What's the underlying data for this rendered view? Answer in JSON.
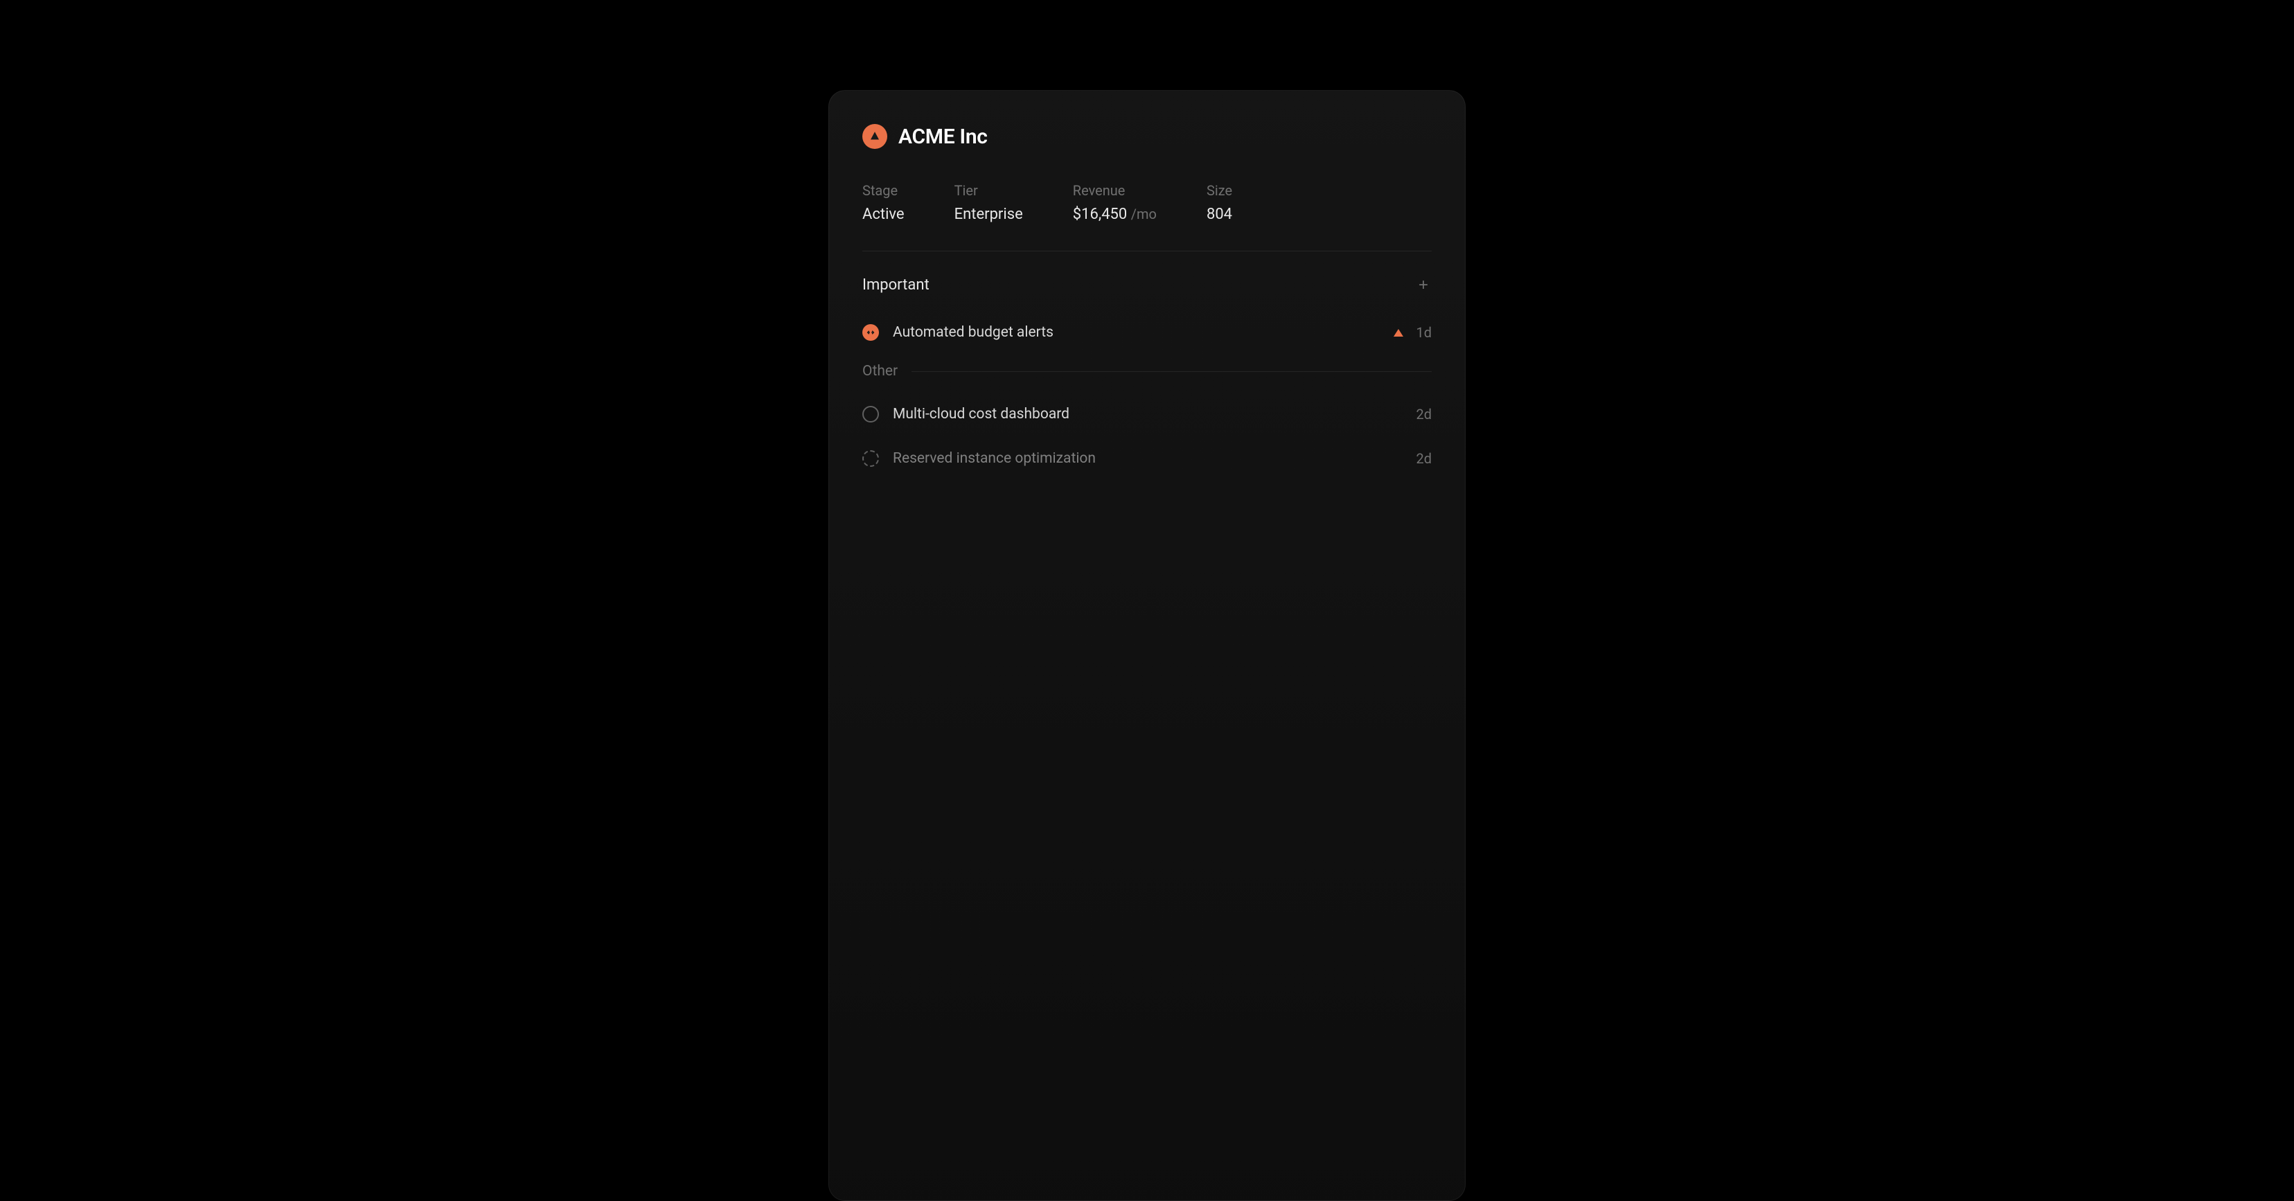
{
  "company": {
    "name": "ACME Inc"
  },
  "stats": {
    "stage": {
      "label": "Stage",
      "value": "Active"
    },
    "tier": {
      "label": "Tier",
      "value": "Enterprise"
    },
    "revenue": {
      "label": "Revenue",
      "value": "$16,450",
      "suffix": "/mo"
    },
    "size": {
      "label": "Size",
      "value": "804"
    }
  },
  "sections": {
    "important": {
      "title": "Important",
      "items": [
        {
          "title": "Automated budget alerts",
          "time": "1d"
        }
      ]
    },
    "other": {
      "title": "Other",
      "items": [
        {
          "title": "Multi-cloud cost dashboard",
          "time": "2d"
        },
        {
          "title": "Reserved instance optimization",
          "time": "2d"
        }
      ]
    }
  }
}
